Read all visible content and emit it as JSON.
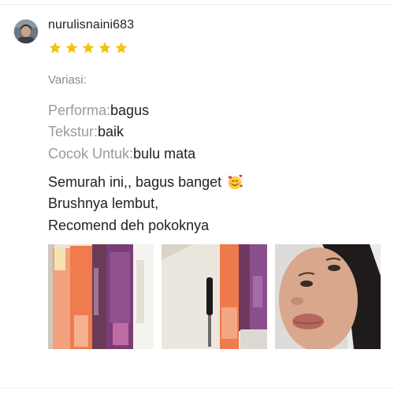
{
  "review": {
    "username": "nurulisnaini683",
    "rating": 5,
    "rating_max": 5,
    "variation_label": "Variasi:",
    "attributes": [
      {
        "label": "Performa:",
        "value": "bagus"
      },
      {
        "label": "Tekstur:",
        "value": "baik"
      },
      {
        "label": "Cocok Untuk:",
        "value": "bulu mata"
      }
    ],
    "comment_lines": [
      "Semurah ini,, bagus banget",
      "Brushnya lembut,",
      "Recomend deh pokoknya"
    ],
    "comment_emoji": "smiling-face-with-hearts-emoji",
    "photos": [
      {
        "icon": "product-photo-mascara-packages"
      },
      {
        "icon": "product-photo-mascara-brush"
      },
      {
        "icon": "reviewer-selfie-photo"
      }
    ]
  },
  "colors": {
    "star": "#f6c20a",
    "label_gray": "#9a9a9a",
    "text": "#222222"
  }
}
